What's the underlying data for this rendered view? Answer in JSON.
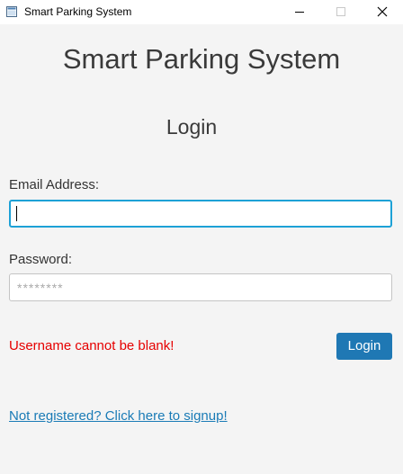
{
  "window": {
    "title": "Smart Parking System",
    "controls": [
      "minimize-icon",
      "maximize-icon",
      "close-icon"
    ]
  },
  "header": {
    "app_title": "Smart Parking System",
    "section_title": "Login"
  },
  "form": {
    "email": {
      "label": "Email Address:",
      "value": "",
      "placeholder": ""
    },
    "password": {
      "label": "Password:",
      "value": "",
      "placeholder": "********"
    },
    "error_message": "Username cannot be blank!",
    "login_button_label": "Login",
    "signup_link_text": "Not registered? Click here to signup!"
  },
  "colors": {
    "background": "#f4f4f4",
    "focus_border": "#1da1d6",
    "error": "#e60000",
    "button": "#1f78b4",
    "link": "#1a7bb6"
  }
}
